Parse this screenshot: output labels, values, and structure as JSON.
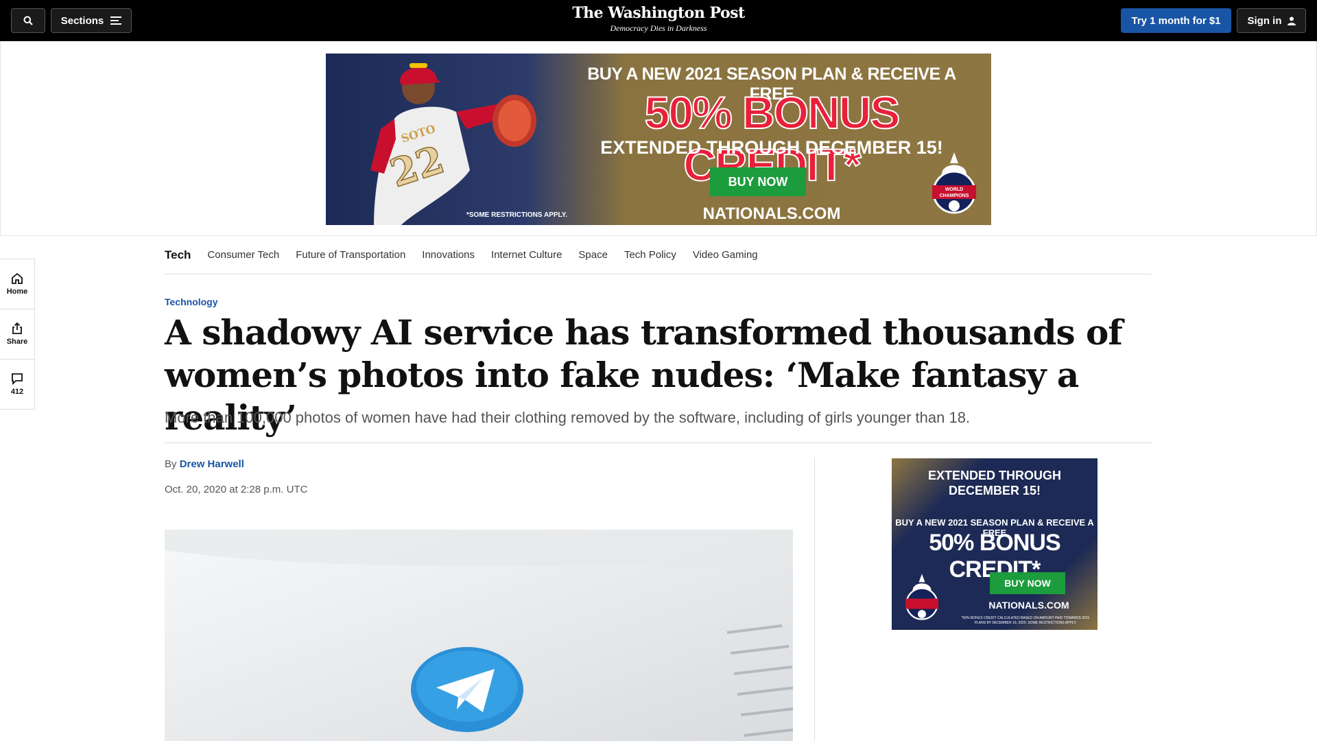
{
  "header": {
    "sections_label": "Sections",
    "logo": "The Washington Post",
    "tagline": "Democracy Dies in Darkness",
    "try_label": "Try 1 month for $1",
    "signin_label": "Sign in",
    "icons": [
      "search-icon",
      "menu-icon",
      "user-icon"
    ]
  },
  "ad_top": {
    "line1": "BUY A NEW 2021 SEASON PLAN & RECEIVE A FREE",
    "line2": "50% BONUS CREDIT*",
    "line3": "EXTENDED THROUGH DECEMBER 15!",
    "buy": "BUY NOW",
    "site": "NATIONALS.COM",
    "restrictions": "*SOME RESTRICTIONS APPLY.",
    "badge": "2019 WORLD CHAMPIONS",
    "jersey_name": "SOTO",
    "jersey_number": "22"
  },
  "rail": {
    "home": "Home",
    "share": "Share",
    "comments": "412"
  },
  "subnav": {
    "head": "Tech",
    "items": [
      "Consumer Tech",
      "Future of Transportation",
      "Innovations",
      "Internet Culture",
      "Space",
      "Tech Policy",
      "Video Gaming"
    ]
  },
  "article": {
    "kicker": "Technology",
    "headline": "A shadowy AI service has transformed thousands of women’s photos into fake nudes: ‘Make fantasy a reality’",
    "dek": "More than 100,000 photos of women have had their clothing removed by the software, including of girls younger than 18.",
    "by": "By",
    "author": "Drew Harwell",
    "date": "Oct. 20, 2020 at 2:28 p.m. UTC"
  },
  "ad_side": {
    "line1": "EXTENDED THROUGH DECEMBER 15!",
    "line2": "BUY A NEW 2021 SEASON PLAN & RECEIVE A FREE",
    "line3": "50% BONUS CREDIT*",
    "buy": "BUY NOW",
    "site": "NATIONALS.COM",
    "fine": "*50% BONUS CREDIT CALCULATED BASED ON AMOUNT PAID TOWARDS 2021 PLANS BY DECEMBER 15, 2020. SOME RESTRICTIONS APPLY.",
    "badge": "2019 WORLD CHAMPIONS"
  },
  "colors": {
    "accent": "#1955a5",
    "topbar": "#000000",
    "ad_navy": "#1d2a55",
    "ad_gold": "#8e7642",
    "ad_red": "#e8203a",
    "ad_green": "#1c9c3c"
  }
}
